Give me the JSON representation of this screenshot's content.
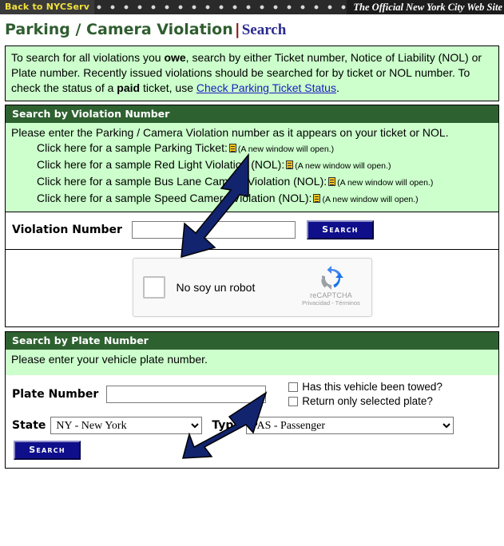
{
  "topbar": {
    "back_link": "Back to NYCServ",
    "official_text": "The Official New York City Web Site"
  },
  "title": {
    "main": "Parking / Camera Violation",
    "separator": "|",
    "sub": "Search"
  },
  "intro": {
    "part1": "To search for all violations you ",
    "bold1": "owe",
    "part2": ", search by either Ticket number, Notice of Liability (NOL) or Plate number. Recently issued violations should be searched for by ticket or NOL number. To check the status of a ",
    "bold2": "paid",
    "part3": " ticket, use ",
    "link": "Check Parking Ticket Status",
    "part4": "."
  },
  "violation_section": {
    "header": "Search by Violation Number",
    "instruction": "Please enter the Parking / Camera Violation number as it appears on your ticket or NOL.",
    "samples": [
      {
        "text": "Click here for a sample Parking Ticket:",
        "icon": "document-icon",
        "note": "(A new window will open.)"
      },
      {
        "text": "Click here for a sample Red Light Violation (NOL):",
        "icon": "document-icon",
        "note": "(A new window will open.)"
      },
      {
        "text": "Click here for a sample Bus Lane Camera Violation (NOL):",
        "icon": "document-icon",
        "note": "(A new window will open.)"
      },
      {
        "text": "Click here for a sample Speed Camera Violation (NOL):",
        "icon": "document-icon",
        "note": "(A new window will open.)"
      }
    ],
    "field_label": "Violation Number",
    "field_value": "",
    "field_placeholder": "",
    "search_button": "Search"
  },
  "captcha": {
    "label": "No soy un robot",
    "brand": "reCAPTCHA",
    "terms": "Privacidad - Términos",
    "checked": false,
    "logo": "recaptcha-logo-icon"
  },
  "plate_section": {
    "header": "Search by Plate Number",
    "instruction": "Please enter your vehicle plate number.",
    "field_label": "Plate Number",
    "field_value": "",
    "field_placeholder": "",
    "checkbox_towed": "Has this vehicle been towed?",
    "checkbox_selected_plate": "Return only selected plate?",
    "state_label": "State",
    "state_value": "NY - New York",
    "type_label": "Type",
    "type_value": "PAS - Passenger",
    "search_button": "Search"
  },
  "annotations": {
    "arrow1": "arrow-pointing-to-violation-number-field",
    "arrow2": "arrow-pointing-to-plate-number-field",
    "color": "#12246e"
  },
  "colors": {
    "section_green": "#2e6130",
    "panel_green": "#ccffcc",
    "button_blue": "#0f0f8c",
    "title_green": "#2f5d2f",
    "title_navy": "#2b2b8f",
    "accent_yellow": "#f2e23c"
  }
}
